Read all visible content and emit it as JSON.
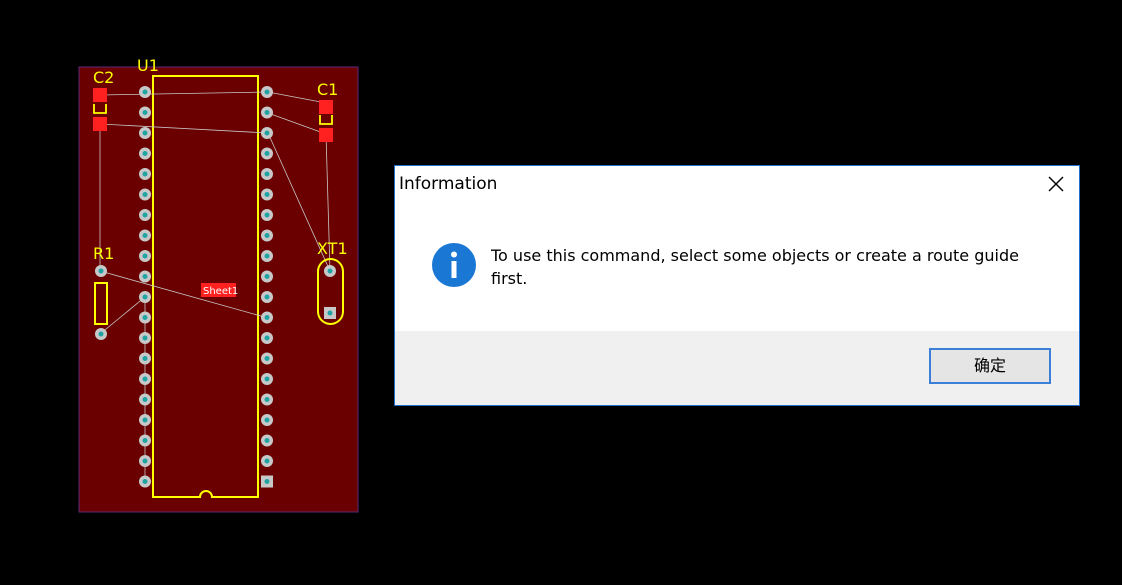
{
  "pcb": {
    "designators": {
      "c2": "C2",
      "u1": "U1",
      "c1": "C1",
      "r1": "R1",
      "xt1": "XT1"
    },
    "sheet_label": "Sheet1",
    "colors": {
      "board": "#6b0000",
      "silkscreen": "#ffff00",
      "pad": "#c8c8c8",
      "via_hole": "#1fa3a3",
      "smd_pad": "#ff2020",
      "ratsnest": "#c8c8c8"
    }
  },
  "dialog": {
    "title": "Information",
    "message": "To use this command, select some objects or create a route guide first.",
    "ok_label": "确定",
    "icon": "info-icon",
    "close_icon": "close-icon"
  }
}
